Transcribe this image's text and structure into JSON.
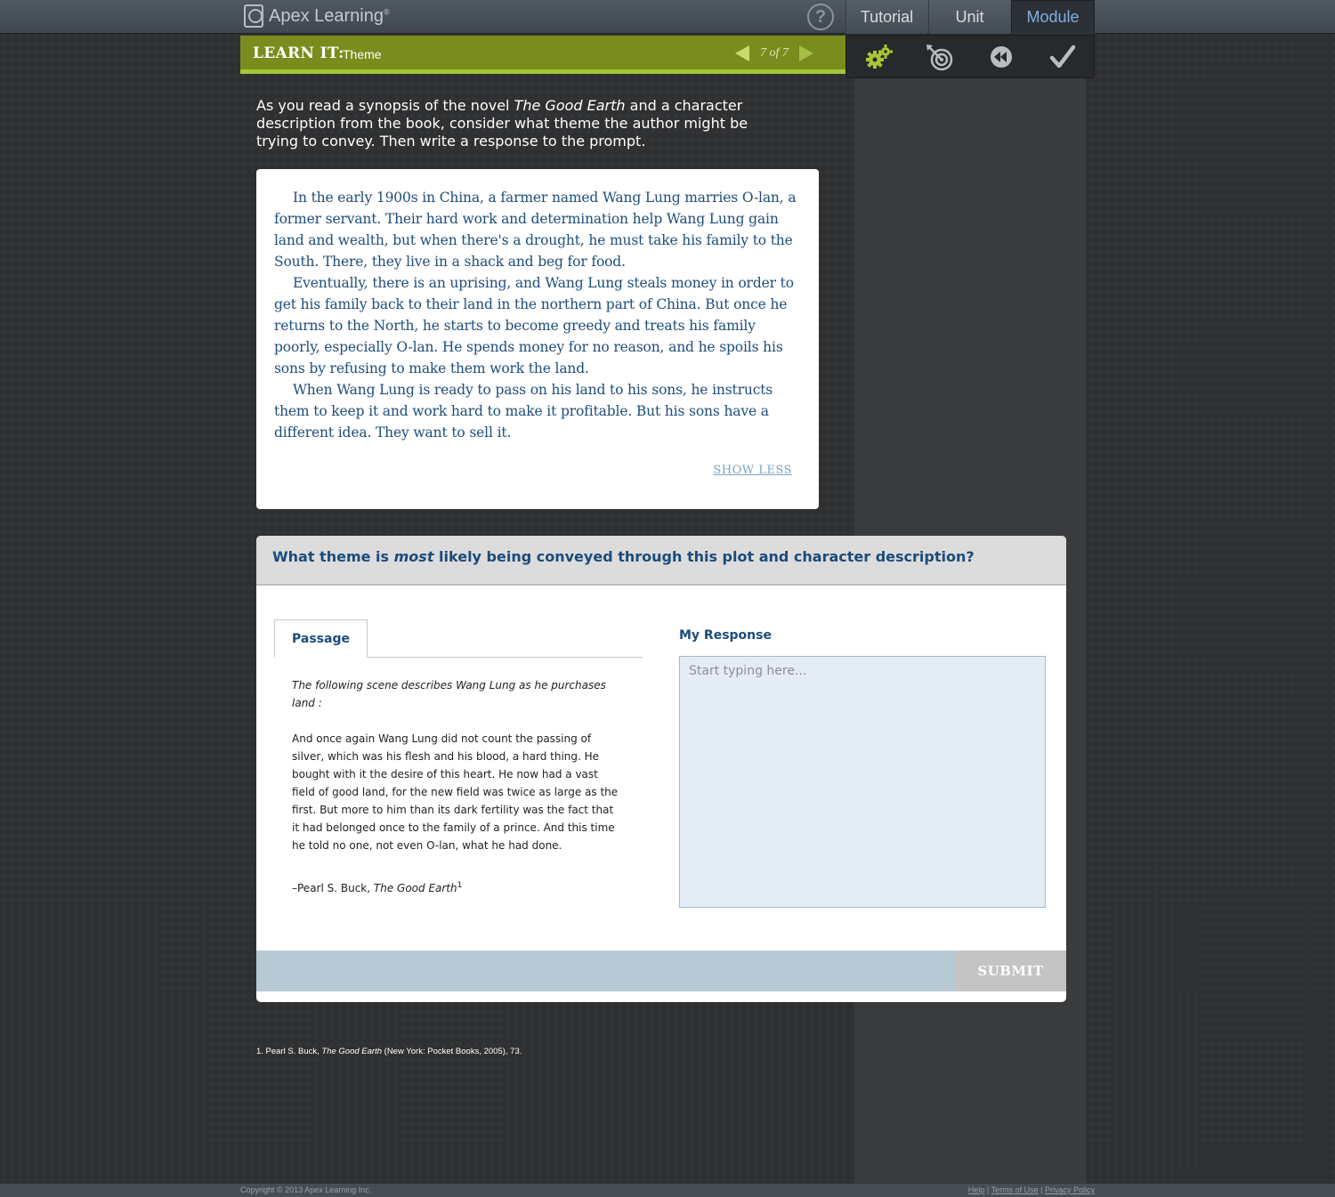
{
  "app": {
    "brand": "Apex Learning",
    "brand_mark": "®",
    "help_label": "?"
  },
  "nav": {
    "tabs": [
      {
        "label": "Tutorial"
      },
      {
        "label": "Unit"
      },
      {
        "label": "Module"
      }
    ],
    "active": "Module"
  },
  "learn_bar": {
    "title": "LEARN IT",
    "separator": ":",
    "subtitle": "Theme",
    "page_current": "7",
    "page_of": "of",
    "page_total": "7"
  },
  "tools": {
    "icons": [
      "gears-icon",
      "target-icon",
      "rewind-icon",
      "checkmark-icon"
    ],
    "accent": "#a8c636"
  },
  "intro": {
    "before": "As you read a synopsis of the novel ",
    "title": "The Good Earth",
    "after": " and a character description from the book, consider what theme the author might be trying to convey. Then write a response to the prompt."
  },
  "synopsis": {
    "paragraphs": [
      "In the early 1900s in China, a farmer named Wang Lung marries O-lan, a former servant. Their hard work and determination help Wang Lung gain land and wealth, but when there's a drought, he must take his family to the South. There, they live in a shack and beg for food.",
      "Eventually, there is an uprising, and Wang Lung steals money in order to get his family back to their land in the northern part of China. But once he returns to the North, he starts to become greedy and treats his family poorly, especially O-lan. He spends money for no reason, and he spoils his sons by refusing to make them work the land.",
      "When Wang Lung is ready to pass on his land to his sons, he instructs them to keep it and work hard to make it profitable. But his sons have a different idea. They want to sell it."
    ],
    "show_less": "SHOW LESS"
  },
  "question": {
    "before": "What theme is ",
    "emphasis": "most",
    "after": " likely being conveyed through this plot and character description?"
  },
  "passage": {
    "tab_label": "Passage",
    "lead": "The following scene describes Wang Lung as he purchases land",
    "lead_colon": ":",
    "body": "And once again Wang Lung did not count the passing of silver, which was his flesh and his blood, a hard thing. He bought with it the desire of this heart. He now had a vast field of good land, for the new field was twice as large as the first. But more to him than its dark fertility was the fact that it had belonged once to the family of a prince. And this time he told no one, not even O-lan, what he had done.",
    "attribution_prefix": "–Pearl S. Buck, ",
    "attribution_title": "The Good Earth",
    "footnote_mark": "1"
  },
  "response": {
    "label": "My Response",
    "value": "",
    "placeholder": "Start typing here..."
  },
  "submit_label": "SUBMIT",
  "footnote": {
    "prefix": "1. Pearl S. Buck, ",
    "title": "The Good Earth",
    "suffix": " (New York: Pocket Books, 2005), 73."
  },
  "footer": {
    "copyright": "Copyright © 2013 Apex Learning Inc.",
    "links": [
      "Help",
      "Terms of Use",
      "Privacy Policy"
    ],
    "sep": "|"
  }
}
